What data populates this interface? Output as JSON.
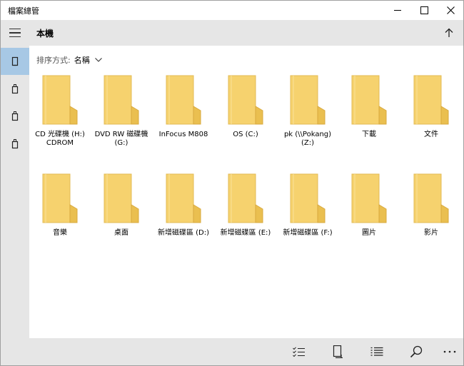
{
  "window": {
    "title": "檔案總管"
  },
  "header": {
    "title": "本機"
  },
  "sort": {
    "label": "排序方式:",
    "value": "名稱"
  },
  "colors": {
    "accent": "#a7c8e5",
    "chrome": "#e6e6e6",
    "folder": "#f8d775",
    "folder_dark": "#e6b94c"
  },
  "sidebar": {
    "items": [
      {
        "icon": "device-icon",
        "active": true
      },
      {
        "icon": "usb-drive-icon",
        "active": false
      },
      {
        "icon": "usb-drive-icon",
        "active": false
      },
      {
        "icon": "usb-drive-icon",
        "active": false
      }
    ]
  },
  "items": [
    {
      "label": "CD 光碟機 (H:) CDROM",
      "icon": "folder-icon"
    },
    {
      "label": "DVD RW 磁碟機 (G:)",
      "icon": "folder-icon"
    },
    {
      "label": "InFocus M808",
      "icon": "folder-icon"
    },
    {
      "label": "OS (C:)",
      "icon": "folder-icon"
    },
    {
      "label": "pk (\\\\Pokang) (Z:)",
      "icon": "folder-icon"
    },
    {
      "label": "下載",
      "icon": "folder-icon"
    },
    {
      "label": "文件",
      "icon": "folder-icon"
    },
    {
      "label": "音樂",
      "icon": "folder-icon"
    },
    {
      "label": "桌面",
      "icon": "folder-icon"
    },
    {
      "label": "新增磁碟區 (D:)",
      "icon": "folder-icon"
    },
    {
      "label": "新增磁碟區 (E:)",
      "icon": "folder-icon"
    },
    {
      "label": "新增磁碟區 (F:)",
      "icon": "folder-icon"
    },
    {
      "label": "圖片",
      "icon": "folder-icon"
    },
    {
      "label": "影片",
      "icon": "folder-icon"
    }
  ],
  "bottombar": {
    "buttons": [
      "select-list-icon",
      "new-device-icon",
      "list-view-icon",
      "search-icon",
      "more-icon"
    ]
  }
}
